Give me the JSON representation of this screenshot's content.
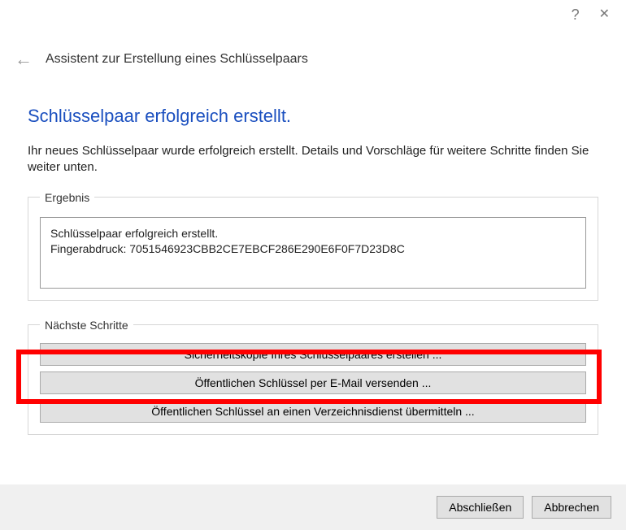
{
  "titlebar": {
    "help": "?",
    "close": "✕"
  },
  "header": {
    "back_arrow": "←",
    "assistant_title": "Assistent zur Erstellung eines Schlüsselpaars"
  },
  "heading": "Schlüsselpaar erfolgreich erstellt.",
  "description": "Ihr neues Schlüsselpaar wurde erfolgreich erstellt. Details und Vorschläge für weitere Schritte finden Sie weiter unten.",
  "result": {
    "legend": "Ergebnis",
    "line1": "Schlüsselpaar erfolgreich erstellt.",
    "line2": "Fingerabdruck: 7051546923CBB2CE7EBCF286E290E6F0F7D23D8C"
  },
  "next_steps": {
    "legend": "Nächste Schritte",
    "btn_backup": "Sicherheitskopie Ihres Schlüsselpaares erstellen ...",
    "btn_email": "Öffentlichen Schlüssel per E-Mail versenden ...",
    "btn_directory": "Öffentlichen Schlüssel an einen Verzeichnisdienst übermitteln ..."
  },
  "buttons": {
    "finish": "Abschließen",
    "cancel": "Abbrechen"
  }
}
